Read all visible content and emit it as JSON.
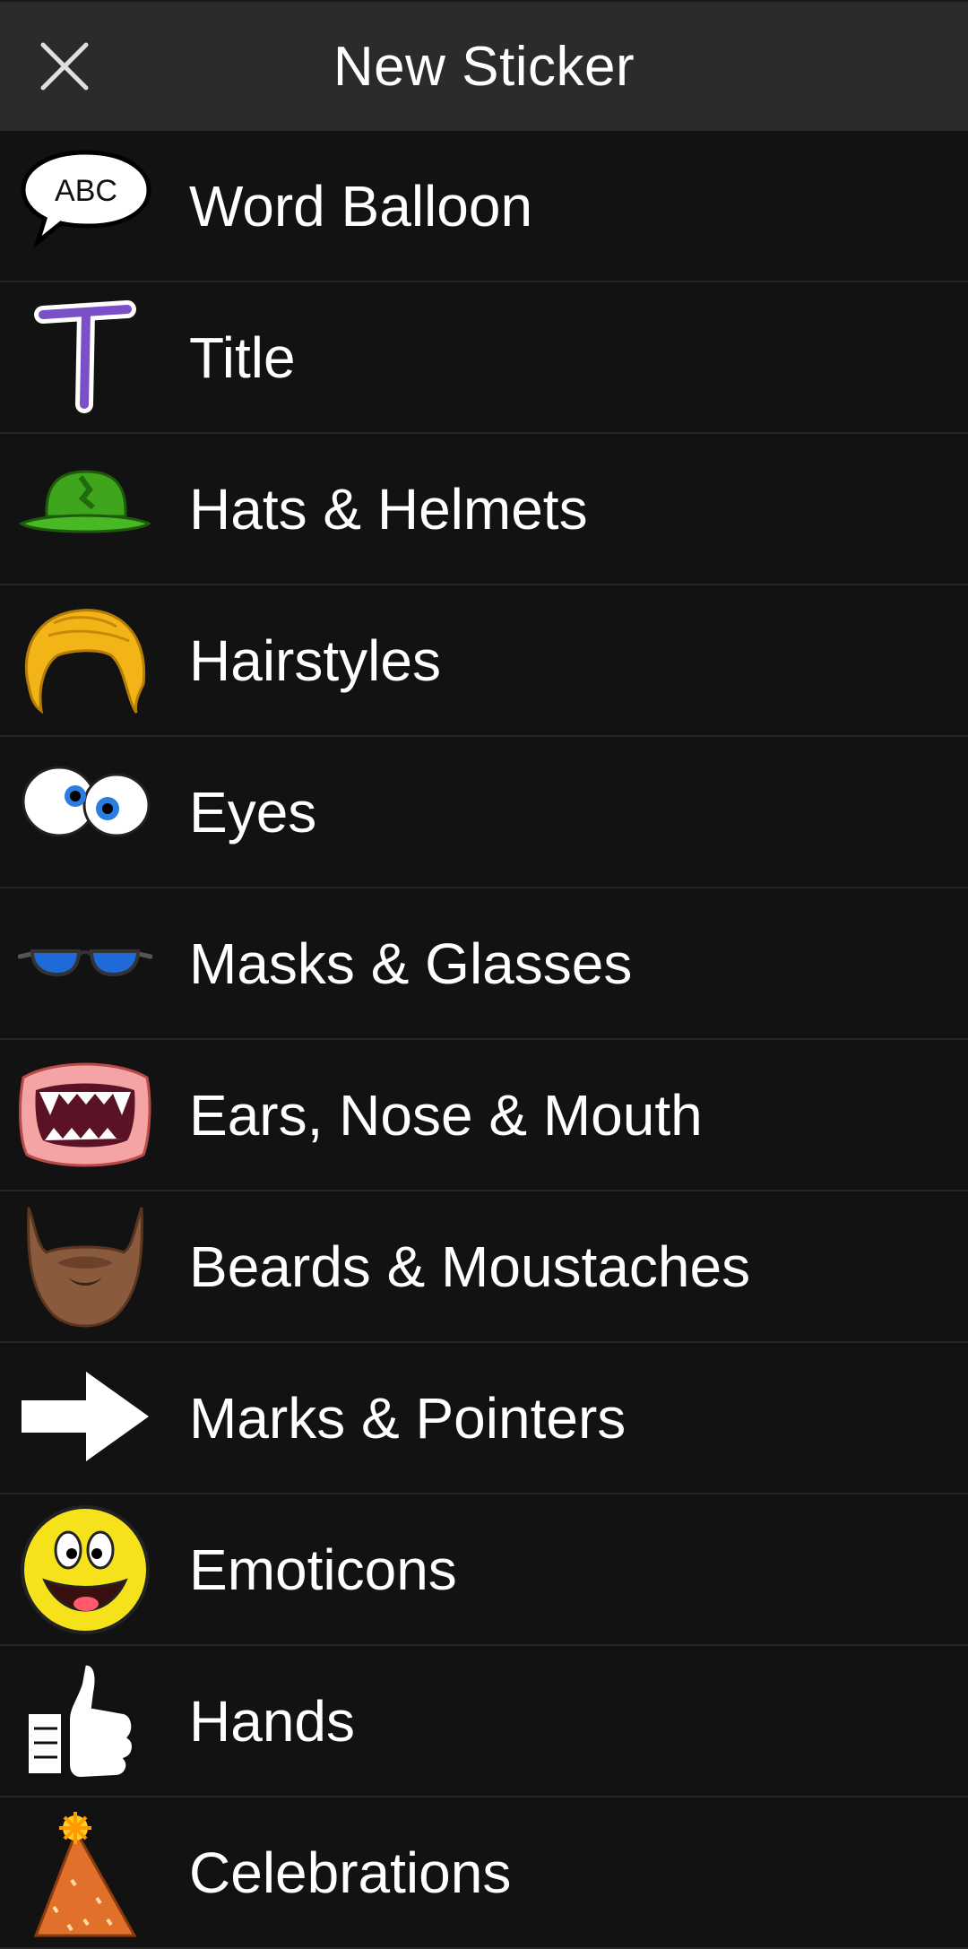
{
  "header": {
    "title": "New Sticker",
    "close_icon": "close-icon"
  },
  "categories": [
    {
      "label": "Word Balloon",
      "icon": "word-balloon-icon",
      "icon_text": "ABC"
    },
    {
      "label": "Title",
      "icon": "title-letter-icon"
    },
    {
      "label": "Hats & Helmets",
      "icon": "bowler-hat-icon"
    },
    {
      "label": "Hairstyles",
      "icon": "hairstyle-icon"
    },
    {
      "label": "Eyes",
      "icon": "cartoon-eyes-icon"
    },
    {
      "label": "Masks & Glasses",
      "icon": "sunglasses-icon"
    },
    {
      "label": "Ears, Nose & Mouth",
      "icon": "vampire-mouth-icon"
    },
    {
      "label": "Beards & Moustaches",
      "icon": "beard-icon"
    },
    {
      "label": "Marks & Pointers",
      "icon": "arrow-pointer-icon"
    },
    {
      "label": "Emoticons",
      "icon": "smiley-face-icon"
    },
    {
      "label": "Hands",
      "icon": "thumbs-up-icon"
    },
    {
      "label": "Celebrations",
      "icon": "party-hat-icon"
    }
  ],
  "colors": {
    "header_bg": "#2b2b2b",
    "list_bg": "#121212",
    "divider": "#262626",
    "text": "#ffffff"
  }
}
